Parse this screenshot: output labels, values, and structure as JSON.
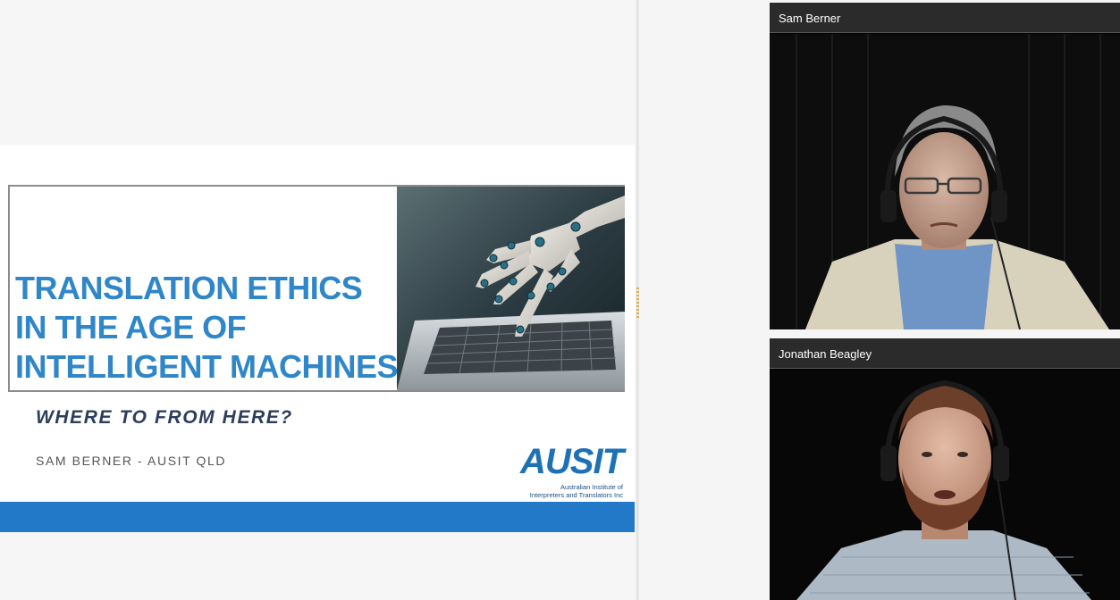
{
  "presentation": {
    "title_lines": [
      "TRANSLATION ETHICS",
      "IN THE AGE OF",
      "INTELLIGENT MACHINES"
    ],
    "subtitle": "WHERE TO FROM HERE?",
    "author": "SAM BERNER - AUSIT QLD",
    "logo": {
      "wordmark": "AUSIT",
      "line1": "Australian Institute of",
      "line2": "Interpreters and Translators Inc"
    },
    "accent_color": "#2f86c8",
    "bar_color": "#2179c7"
  },
  "participants": [
    {
      "name": "Sam Berner"
    },
    {
      "name": "Jonathan Beagley"
    }
  ],
  "icons": {
    "slide_image": "robot-hand-laptop-image",
    "divider_handle": "resize-handle-icon"
  }
}
